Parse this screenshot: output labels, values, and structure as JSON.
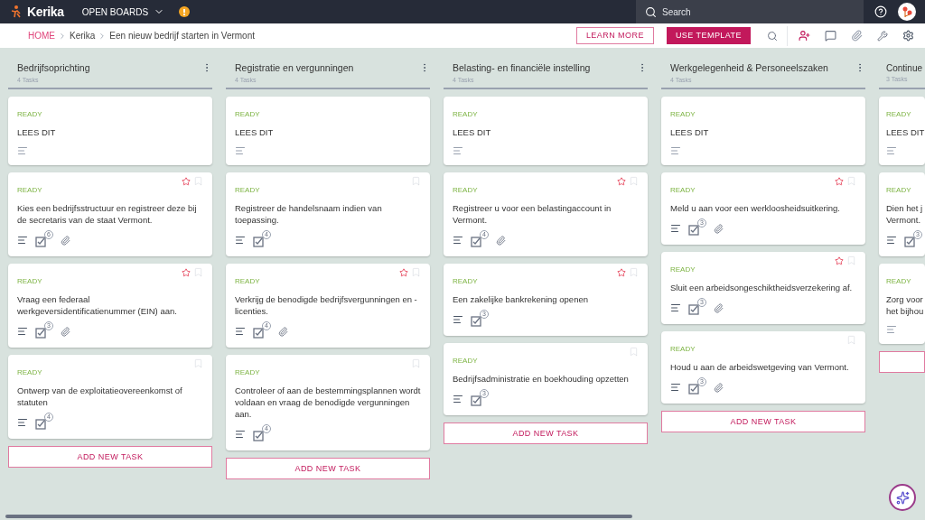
{
  "topbar": {
    "logo": "Kerika",
    "menu": "OPEN BOARDS",
    "search_placeholder": "Search"
  },
  "breadcrumb": [
    "HOME",
    "Kerika",
    "Een nieuw bedrijf starten in Vermont"
  ],
  "actions": {
    "learn_more": "LEARN MORE",
    "use_template": "USE TEMPLATE"
  },
  "columns": [
    {
      "title": "Bedrijfsoprichting",
      "count": "4 Tasks",
      "add_label": "ADD NEW TASK",
      "tasks": [
        {
          "status": "READY",
          "title": "LEES DIT",
          "starred": false,
          "bookmark": false,
          "attachment": false
        },
        {
          "status": "READY",
          "title": "Kies een bedrijfsstructuur en registreer deze bij de secretaris van de staat Vermont.",
          "starred": true,
          "bookmark": true,
          "checklist": "6",
          "attachment": true
        },
        {
          "status": "READY",
          "title": "Vraag een federaal werkgeversidentificatienummer (EIN) aan.",
          "starred": true,
          "bookmark": true,
          "checklist": "3",
          "attachment": true
        },
        {
          "status": "READY",
          "title": "Ontwerp van de exploitatieovereenkomst of statuten",
          "starred": false,
          "bookmark": true,
          "checklist": "4",
          "attachment": false
        }
      ]
    },
    {
      "title": "Registratie en vergunningen",
      "count": "4 Tasks",
      "add_label": "ADD NEW TASK",
      "tasks": [
        {
          "status": "READY",
          "title": "LEES DIT",
          "starred": false,
          "bookmark": false,
          "attachment": false
        },
        {
          "status": "READY",
          "title": "Registreer de handelsnaam indien van toepassing.",
          "starred": false,
          "bookmark": true,
          "checklist": "4",
          "attachment": false
        },
        {
          "status": "READY",
          "title": "Verkrijg de benodigde bedrijfsvergunningen en -licenties.",
          "starred": true,
          "bookmark": true,
          "checklist": "4",
          "attachment": true
        },
        {
          "status": "READY",
          "title": "Controleer of aan de bestemmingsplannen wordt voldaan en vraag de benodigde vergunningen aan.",
          "starred": false,
          "bookmark": true,
          "checklist": "4",
          "attachment": false
        }
      ]
    },
    {
      "title": "Belasting- en financiële instelling",
      "count": "4 Tasks",
      "add_label": "ADD NEW TASK",
      "tasks": [
        {
          "status": "READY",
          "title": "LEES DIT",
          "starred": false,
          "bookmark": false,
          "attachment": false
        },
        {
          "status": "READY",
          "title": "Registreer u voor een belastingaccount in Vermont.",
          "starred": true,
          "bookmark": true,
          "checklist": "4",
          "attachment": true
        },
        {
          "status": "READY",
          "title": "Een zakelijke bankrekening openen",
          "starred": true,
          "bookmark": true,
          "checklist": "3",
          "attachment": false
        },
        {
          "status": "READY",
          "title": "Bedrijfsadministratie en boekhouding opzetten",
          "starred": false,
          "bookmark": true,
          "checklist": "3",
          "attachment": false
        }
      ]
    },
    {
      "title": "Werkgelegenheid & Personeelszaken",
      "count": "4 Tasks",
      "add_label": "ADD NEW TASK",
      "tasks": [
        {
          "status": "READY",
          "title": "LEES DIT",
          "starred": false,
          "bookmark": false,
          "attachment": false
        },
        {
          "status": "READY",
          "title": "Meld u aan voor een werkloosheidsuitkering.",
          "starred": true,
          "bookmark": true,
          "checklist": "3",
          "attachment": true
        },
        {
          "status": "READY",
          "title": "Sluit een arbeidsongeschiktheidsverzekering af.",
          "starred": true,
          "bookmark": true,
          "checklist": "3",
          "attachment": true
        },
        {
          "status": "READY",
          "title": "Houd u aan de arbeidswetgeving van Vermont.",
          "starred": false,
          "bookmark": true,
          "checklist": "3",
          "attachment": true
        }
      ]
    },
    {
      "title": "Continue",
      "count": "3 Tasks",
      "tasks": [
        {
          "status": "READY",
          "title": "LEES DIT"
        },
        {
          "status": "READY",
          "title": "Dien het j\nVermont.",
          "checklist": "3"
        },
        {
          "status": "READY",
          "title": "Zorg voor\nhet bijhou"
        }
      ]
    }
  ]
}
